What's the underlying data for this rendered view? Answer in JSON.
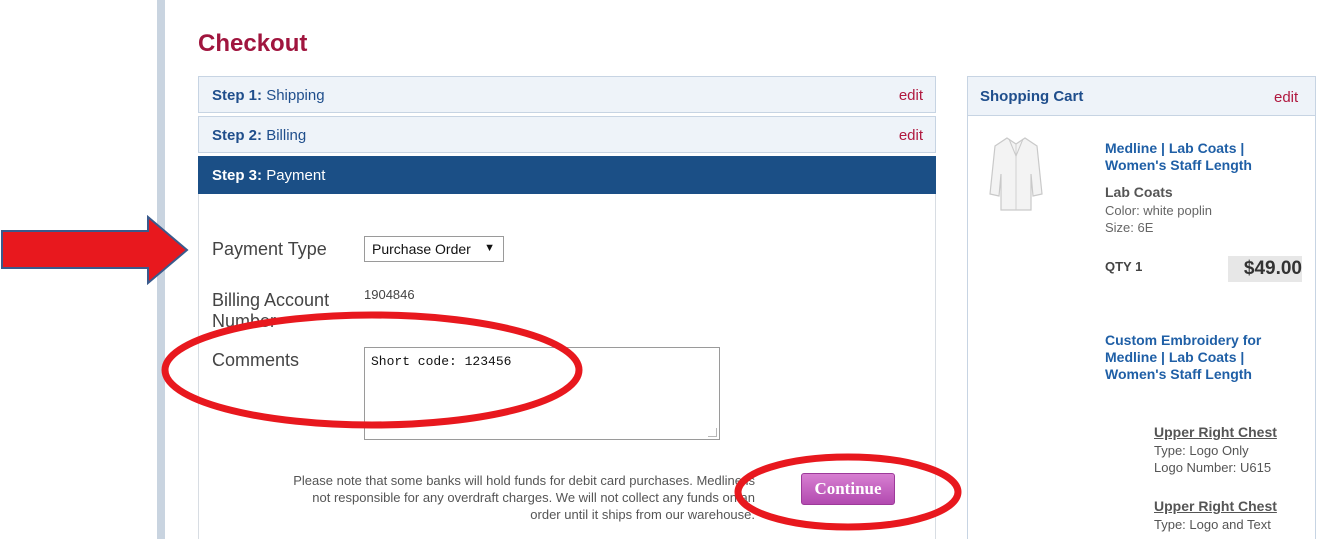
{
  "page": {
    "title": "Checkout"
  },
  "steps": [
    {
      "num": "Step 1:",
      "name": "Shipping",
      "edit": "edit"
    },
    {
      "num": "Step 2:",
      "name": "Billing",
      "edit": "edit"
    },
    {
      "num": "Step 3:",
      "name": "Payment"
    }
  ],
  "payment": {
    "type_label": "Payment Type",
    "type_value": "Purchase Order",
    "account_label_1": "Billing Account",
    "account_label_2": "Number",
    "account_value": "1904846",
    "comments_label": "Comments",
    "comments_value": "Short code: 123456",
    "note_line1": "Please note that some banks will hold funds for debit card purchases. Medline is",
    "note_line2": "not responsible for any overdraft charges. We will not collect any funds on an",
    "note_line3": "order until it ships from our warehouse.",
    "continue_label": "Continue"
  },
  "cart": {
    "title": "Shopping Cart",
    "edit": "edit",
    "product": {
      "name_1": "Medline | Lab Coats |",
      "name_2": "Women's Staff Length",
      "category": "Lab Coats",
      "color": "Color: white poplin",
      "size": "Size: 6E",
      "qty": "QTY 1",
      "price": "$49.00"
    },
    "embroidery": {
      "name_1": "Custom Embroidery for",
      "name_2": "Medline | Lab Coats |",
      "name_3": "Women's Staff Length",
      "locations": [
        {
          "title": "Upper Right Chest",
          "type": "Type: Logo Only",
          "logo": "Logo Number: U615"
        },
        {
          "title": "Upper Right Chest",
          "type": "Type: Logo and Text"
        }
      ]
    }
  },
  "colors": {
    "accent": "#a0153e",
    "step_active": "#1b4f86",
    "annotation": "#e8181e",
    "continue": "#b24ab0"
  }
}
